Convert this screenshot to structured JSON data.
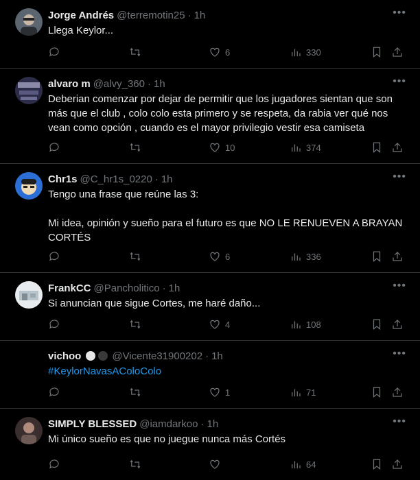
{
  "tweets": [
    {
      "name": "Jorge Andrés",
      "handle": "@terremotin25",
      "time": "1h",
      "text": "Llega Keylor...",
      "replies": "",
      "retweets": "",
      "likes": "6",
      "views": "330",
      "avatar_colors": [
        "#6c7a86",
        "#c9b8a8"
      ]
    },
    {
      "name": "alvaro m",
      "handle": "@alvy_360",
      "time": "1h",
      "text": "Deberian comenzar por dejar de permitir que los jugadores sientan que son más que el club , colo colo esta primero y se respeta, da rabia ver qué nos vean como opción , cuando es el mayor privilegio vestir esa camiseta",
      "replies": "",
      "retweets": "",
      "likes": "10",
      "views": "374",
      "avatar_colors": [
        "#3b3b5c",
        "#8a8aa8"
      ]
    },
    {
      "name": "Chr1s",
      "handle": "@C_hr1s_0220",
      "time": "1h",
      "text": "Tengo una frase que reúne las 3:\n\nMi idea, opinión y sueño para el futuro es que NO LE RENUEVEN A BRAYAN CORTÉS",
      "replies": "",
      "retweets": "",
      "likes": "6",
      "views": "336",
      "avatar_colors": [
        "#2b6fd6",
        "#f0d9b5"
      ]
    },
    {
      "name": "FrankCC",
      "handle": "@Pancholitico",
      "time": "1h",
      "text": "Si anuncian que sigue Cortes, me haré daño...",
      "replies": "",
      "retweets": "",
      "likes": "4",
      "views": "108",
      "avatar_colors": [
        "#e8ecef",
        "#9aa8b0"
      ]
    },
    {
      "name": "vichoo",
      "handle": "@Vicente31900202",
      "time": "1h",
      "text": "",
      "hashtag": "#KeylorNavasAColoColo",
      "replies": "",
      "retweets": "",
      "likes": "1",
      "views": "71",
      "avatar_colors": [
        "#000000",
        "#000000"
      ]
    },
    {
      "name": "SIMPLY BLESSED",
      "handle": "@iamdarkoo",
      "time": "1h",
      "text": "Mi único sueño es que no juegue nunca más Cortés",
      "replies": "",
      "retweets": "",
      "likes": "",
      "views": "64",
      "avatar_colors": [
        "#4a3a3a",
        "#b08a7a"
      ]
    }
  ]
}
